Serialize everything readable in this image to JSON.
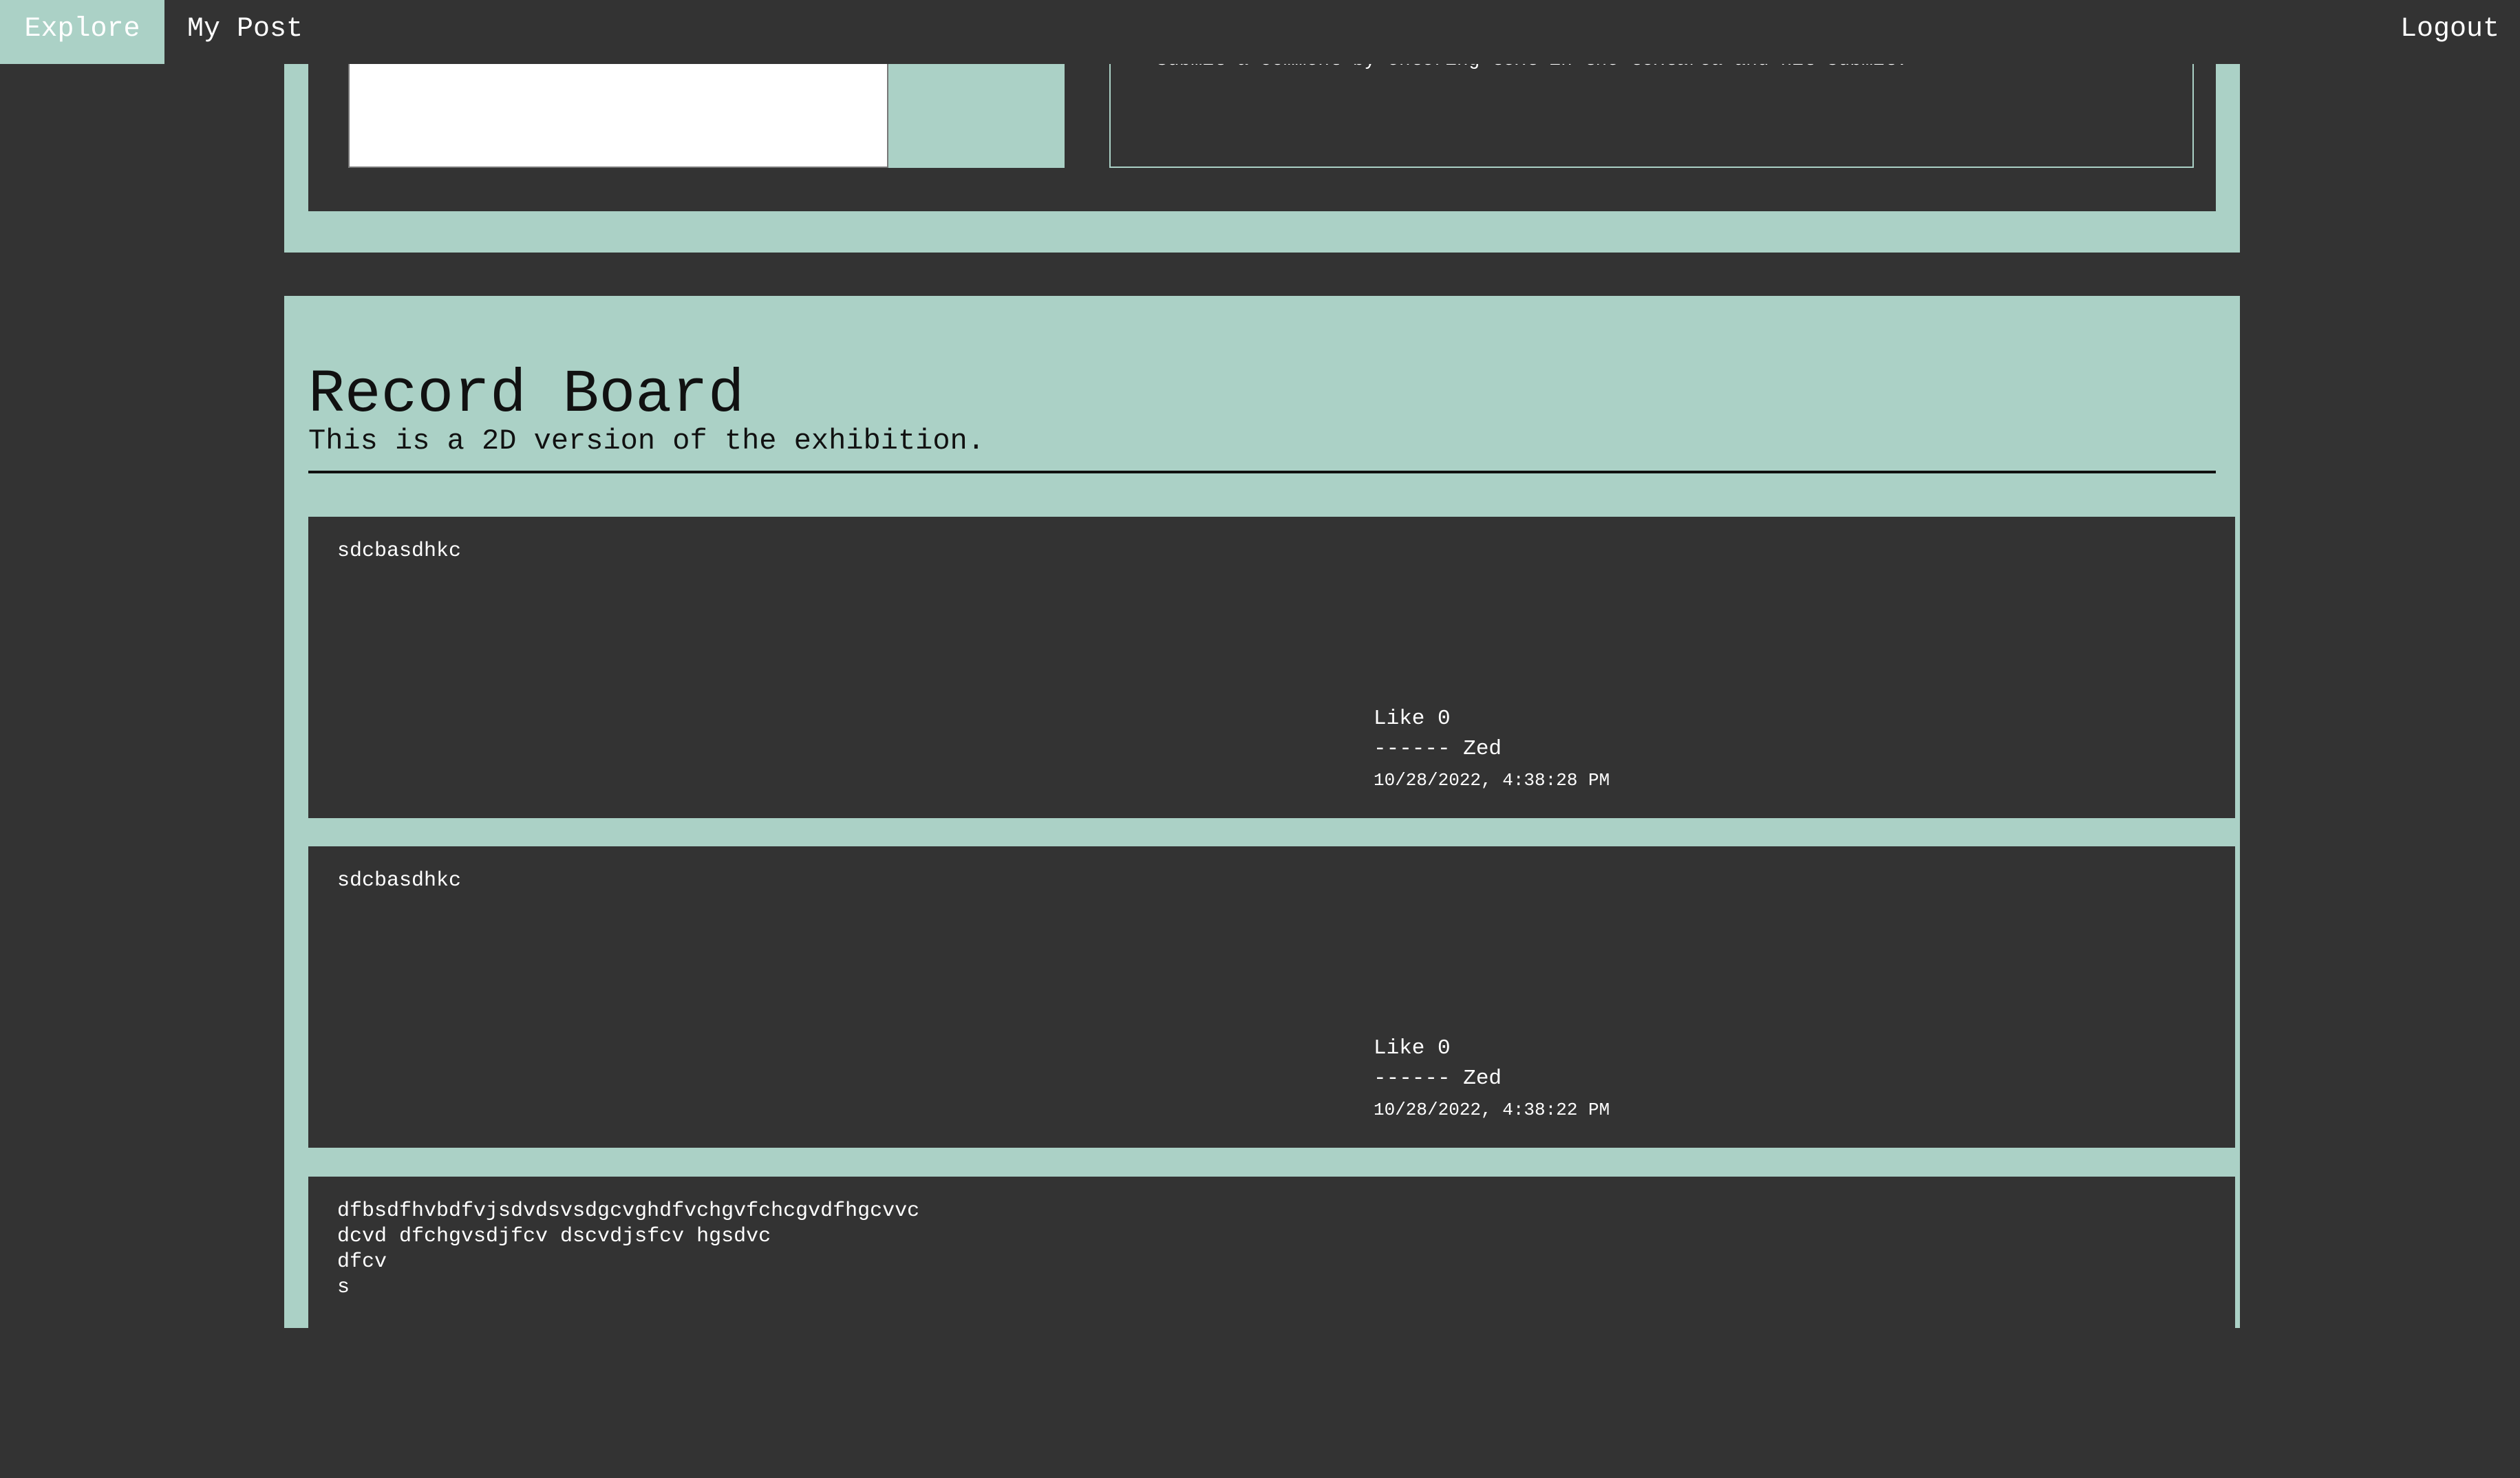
{
  "nav": {
    "explore": "Explore",
    "my_post": "My Post",
    "logout": "Logout"
  },
  "comment_form": {
    "textarea_value": "",
    "submit_label": "",
    "info_text": "Submit a comment by entering text in the textarea and hit submit."
  },
  "record_board": {
    "title": "Record Board",
    "subtitle": "This is a 2D version of the exhibition."
  },
  "posts": [
    {
      "text": "sdcbasdhkc",
      "like_label": "Like 0",
      "author": "------ Zed",
      "date": "10/28/2022, 4:38:28 PM"
    },
    {
      "text": "sdcbasdhkc",
      "like_label": "Like 0",
      "author": "------ Zed",
      "date": "10/28/2022, 4:38:22 PM"
    },
    {
      "text": "dfbsdfhvbdfvjsdvdsvsdgcvghdfvchgvfchcgvdfhgcvvc\ndcvd dfchgvsdjfcv dscvdjsfcv hgsdvc\ndfcv\ns",
      "like_label": "",
      "author": "",
      "date": ""
    }
  ],
  "colors": {
    "background": "#333333",
    "accent": "#abd1c6",
    "text_light": "#ffffff",
    "text_dark": "#111111"
  }
}
